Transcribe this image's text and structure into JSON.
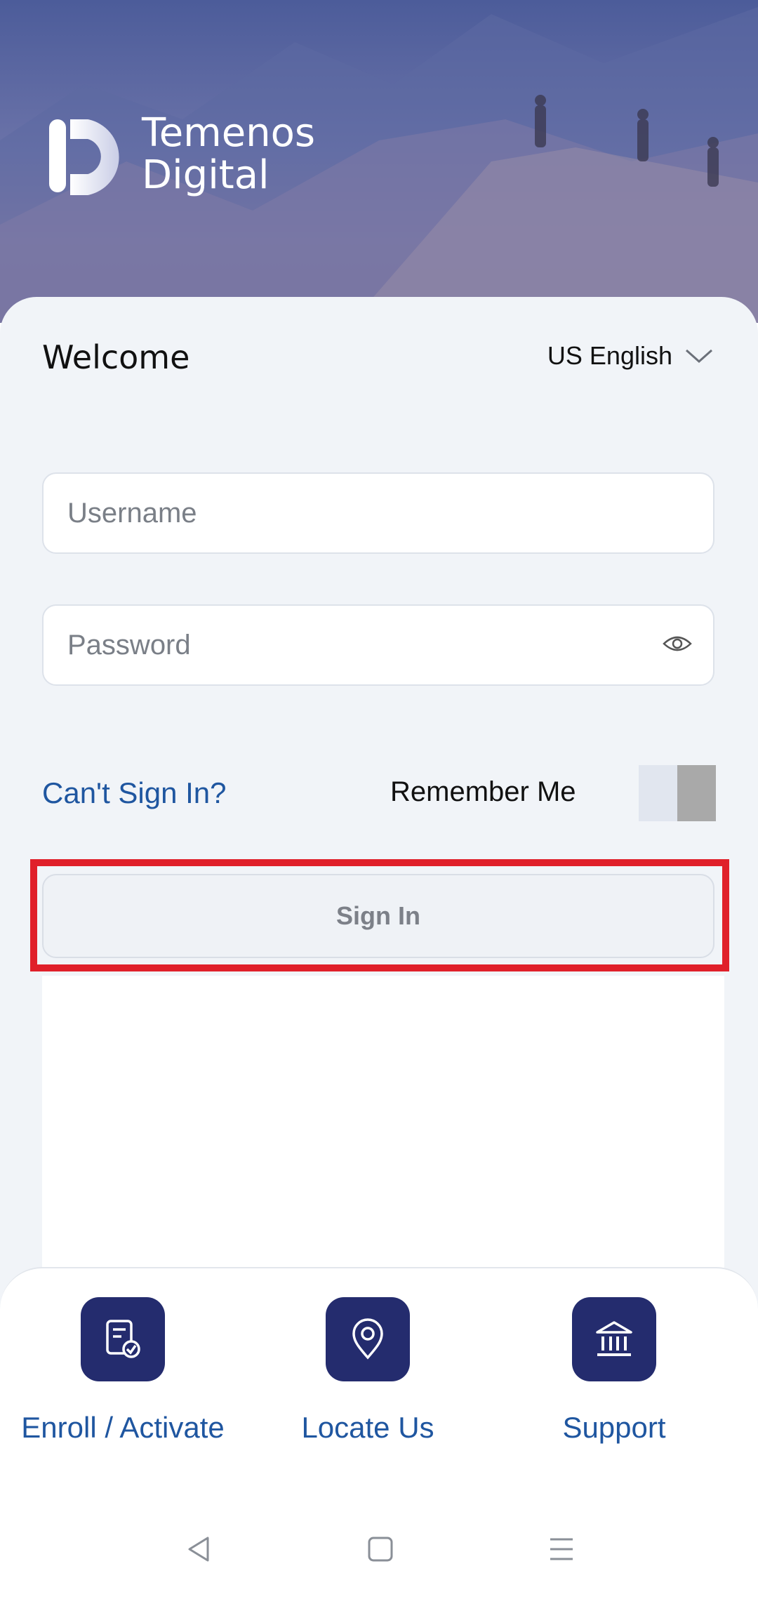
{
  "brand": {
    "name_line1": "Temenos",
    "name_line2": "Digital"
  },
  "header": {
    "welcome": "Welcome",
    "language": "US English"
  },
  "form": {
    "username_placeholder": "Username",
    "password_placeholder": "Password",
    "cant_sign_in": "Can't Sign In?",
    "remember_me": "Remember Me",
    "sign_in": "Sign In"
  },
  "actions": [
    {
      "label": "Enroll / Activate",
      "icon": "document-check-icon"
    },
    {
      "label": "Locate Us",
      "icon": "location-pin-icon"
    },
    {
      "label": "Support",
      "icon": "bank-icon"
    }
  ],
  "colors": {
    "accent": "#1f56a0",
    "tile": "#242c6e",
    "highlight": "#e0202a"
  }
}
